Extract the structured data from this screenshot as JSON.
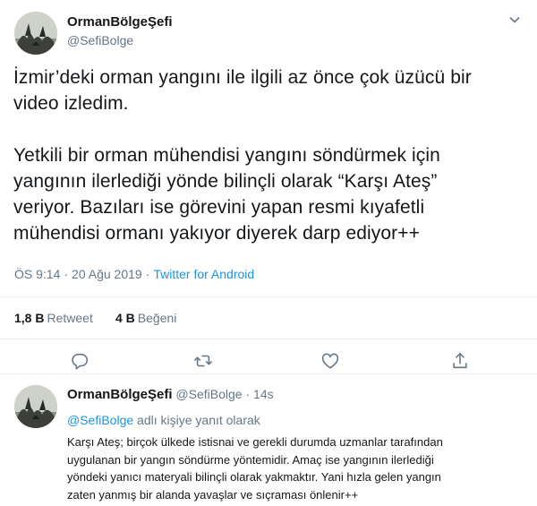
{
  "tweet": {
    "author": {
      "name": "OrmanBölgeŞefi",
      "handle": "@SefiBolge"
    },
    "text": {
      "line1": "İzmir’deki orman yangını ile ilgili az önce çok üzücü bir",
      "line2": "video izledim.",
      "line3": "Yetkili bir orman mühendisi yangını söndürmek için",
      "line4": "yangının ilerlediği yönde bilinçli olarak “Karşı Ateş”",
      "line5": "veriyor. Bazıları ise görevini yapan resmi kıyafetli",
      "line6": "mühendisi ormanı yakıyor diyerek darp ediyor++"
    },
    "time": "ÖS 9:14",
    "separator": "·",
    "date": "20 Ağu 2019",
    "source": "Twitter for Android",
    "stats": {
      "retweet_count": "1,8 B",
      "retweet_label": "Retweet",
      "like_count": "4 B",
      "like_label": "Beğeni"
    },
    "actions": [
      "reply-icon",
      "retweet-icon",
      "like-icon",
      "share-icon"
    ]
  },
  "reply": {
    "name": "OrmanBölgeŞefi",
    "handle": "@SefiBolge",
    "dot": "·",
    "time": "14s",
    "reply_to_mention": "@SefiBolge",
    "reply_to_suffix": "adlı kişiye yanıt olarak",
    "text": {
      "line1": "Karşı Ateş; birçok ülkede istisnai ve gerekli durumda uzmanlar tarafından",
      "line2": "uygulanan bir yangın söndürme yöntemidir. Amaç ise yangının ilerlediği",
      "line3": "yöndeki yanıcı materyali bilinçli olarak yakmaktır. Yani hızla gelen yangın",
      "line4": "zaten yanmış bir alanda yavaşlar ve sıçraması önlenir++"
    }
  },
  "colors": {
    "text": "#14171a",
    "secondary": "#657786",
    "link": "#1b95e0",
    "border": "#e6ecf0"
  }
}
